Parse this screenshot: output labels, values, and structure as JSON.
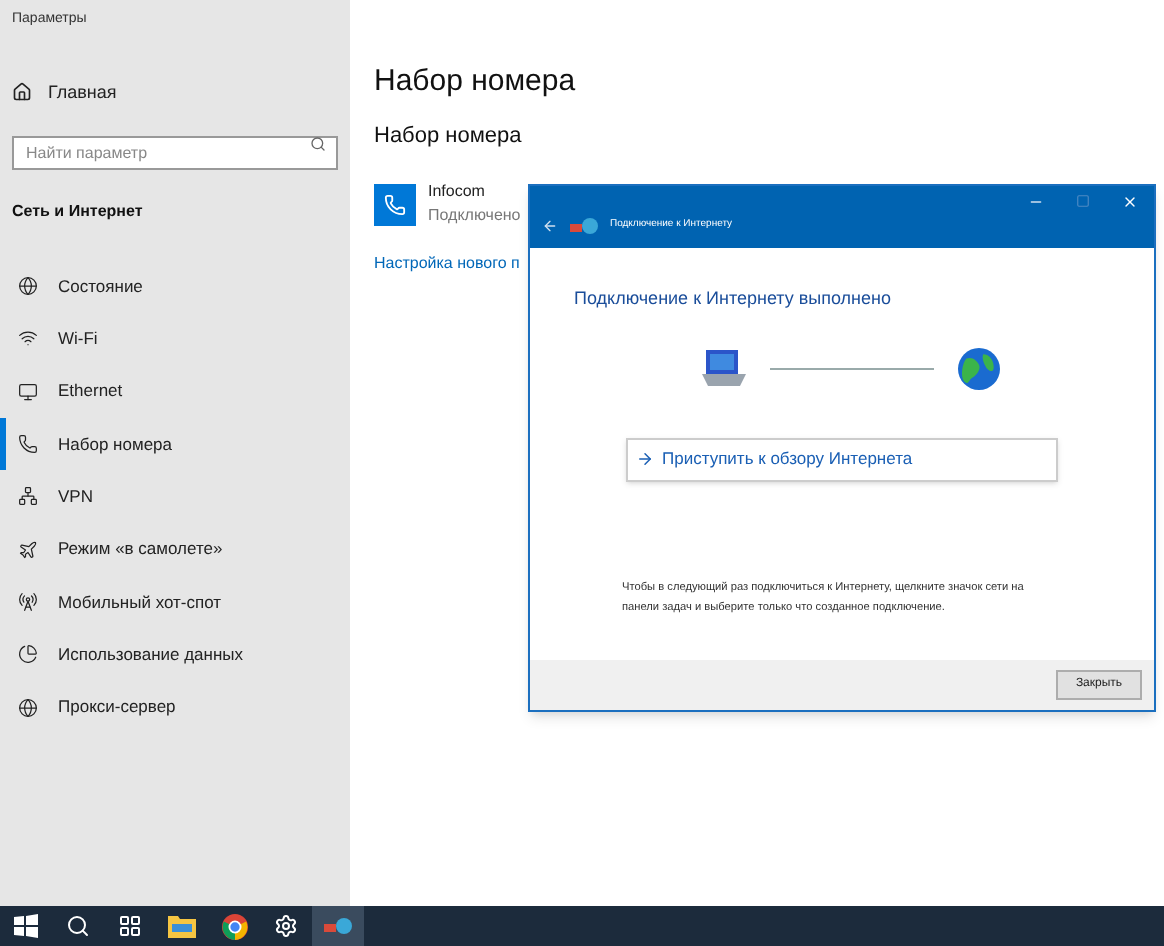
{
  "window": {
    "title": "Параметры"
  },
  "sidebar": {
    "home": "Главная",
    "search": {
      "placeholder": "Найти параметр"
    },
    "section": "Сеть и Интернет",
    "items": [
      {
        "label": "Состояние",
        "selected": false
      },
      {
        "label": "Wi-Fi",
        "selected": false
      },
      {
        "label": "Ethernet",
        "selected": false
      },
      {
        "label": "Набор номера",
        "selected": true
      },
      {
        "label": "VPN",
        "selected": false
      },
      {
        "label": "Режим «в самолете»",
        "selected": false
      },
      {
        "label": "Мобильный хот-спот",
        "selected": false
      },
      {
        "label": "Использование данных",
        "selected": false
      },
      {
        "label": "Прокси-сервер",
        "selected": false
      }
    ]
  },
  "main": {
    "title": "Набор номера",
    "subtitle": "Набор номера",
    "connection": {
      "name": "Infocom",
      "status": "Подключено"
    },
    "link": "Настройка нового п"
  },
  "dialog": {
    "title": "Подключение к Интернету",
    "heading": "Подключение к Интернету выполнено",
    "action": "Приступить к обзору Интернета",
    "note": "Чтобы в следующий раз подключиться к Интернету, щелкните значок сети на панели задач и выберите только что созданное подключение.",
    "buttons": [
      "Закрыть"
    ]
  },
  "taskbar": {
    "items": [
      {
        "kind": "start",
        "selected": false
      },
      {
        "kind": "search",
        "selected": false
      },
      {
        "kind": "taskview",
        "selected": false
      },
      {
        "kind": "explorer",
        "selected": false
      },
      {
        "kind": "browser",
        "selected": false
      },
      {
        "kind": "settings",
        "selected": false
      },
      {
        "kind": "network",
        "selected": true
      }
    ]
  }
}
